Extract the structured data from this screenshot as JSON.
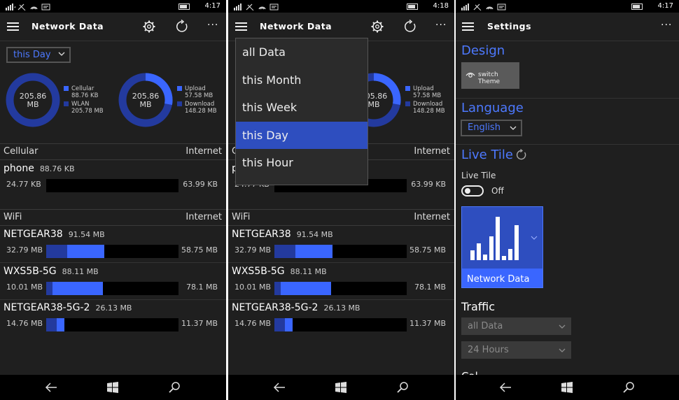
{
  "status": {
    "time_1": "4:17",
    "time_2": "4:18",
    "time_3": "4:17"
  },
  "app": {
    "title": "Network Data",
    "period_selected": "this Day",
    "donut_cellular": {
      "center_value": "205.86",
      "center_unit": "MB",
      "cellular_label": "Cellular",
      "cellular_value": "88.76 KB",
      "wlan_label": "WLAN",
      "wlan_value": "205.78 MB",
      "cellular_fraction": 0.0004
    },
    "donut_direction": {
      "center_value": "205.86",
      "center_unit": "MB",
      "upload_label": "Upload",
      "upload_value": "57.58 MB",
      "download_label": "Download",
      "download_value": "148.28 MB",
      "upload_fraction": 0.28
    },
    "cellular_section": {
      "left": "Cellular",
      "right": "Internet"
    },
    "wifi_section": {
      "left": "WiFi",
      "right": "Internet"
    },
    "rows": [
      {
        "name": "phone",
        "total": "88.76 KB",
        "upload": "24.77 KB",
        "download": "63.99 KB",
        "up_frac": 0.0,
        "down_frac": 0.0
      },
      {
        "name": "NETGEAR38",
        "total": "91.54 MB",
        "upload": "32.79 MB",
        "download": "58.75 MB",
        "up_frac": 0.16,
        "down_frac": 0.28
      },
      {
        "name": "WXS5B-5G",
        "total": "88.11 MB",
        "upload": "10.01 MB",
        "download": "78.1 MB",
        "up_frac": 0.05,
        "down_frac": 0.38
      },
      {
        "name": "NETGEAR38-5G-2",
        "total": "26.13 MB",
        "upload": "14.76 MB",
        "download": "11.37 MB",
        "up_frac": 0.08,
        "down_frac": 0.06
      }
    ]
  },
  "dropdown": {
    "items": [
      "all Data",
      "this Month",
      "this Week",
      "this Day",
      "this Hour"
    ],
    "selected": "this Day"
  },
  "settings": {
    "title": "Settings",
    "design_head": "Design",
    "switch_theme": "switch Theme",
    "language_head": "Language",
    "language_value": "English",
    "livetile_head": "Live Tile",
    "livetile_label": "Live Tile",
    "toggle_state": "Off",
    "tile_label": "Network Data",
    "traffic_head": "Traffic",
    "traffic_select": "all Data",
    "traffic_range": "24 Hours",
    "cut_head": "Cal..."
  },
  "colors": {
    "accent": "#2e4ebf",
    "bright": "#3a66ff",
    "dark_blue": "#233a9e",
    "bg": "#1f1f1f"
  }
}
